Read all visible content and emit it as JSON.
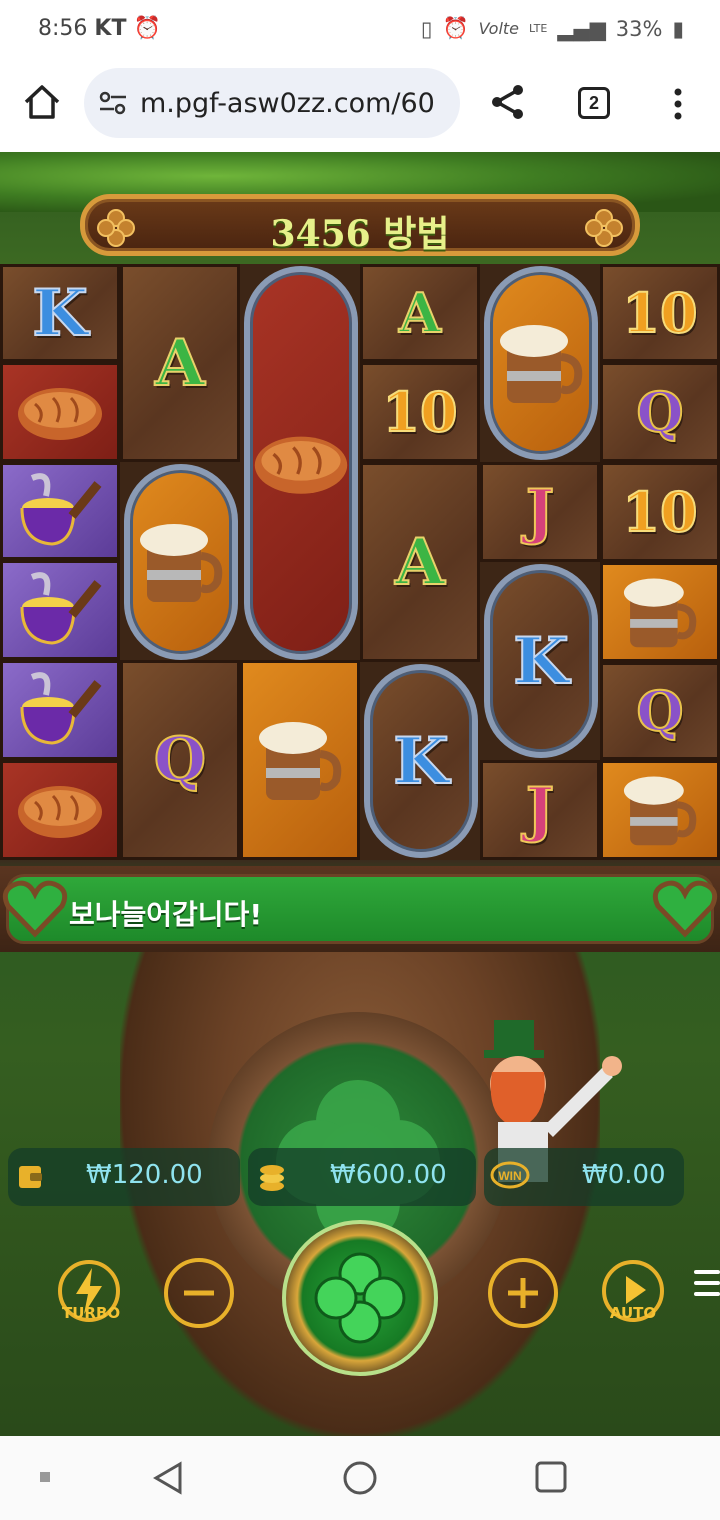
{
  "status_bar": {
    "time": "8:56",
    "carrier": "KT",
    "battery": "33%",
    "network": "LTE"
  },
  "browser": {
    "url": "m.pgf-asw0zz.com/60",
    "tab_count": "2"
  },
  "game": {
    "ways_text": "3456 방법",
    "message": "보나늘어갑니다!",
    "balance": "₩120.00",
    "bet": "₩600.00",
    "win": "₩0.00",
    "turbo_label": "TURBO",
    "auto_label": "AUTO",
    "win_badge": "WIN",
    "accent_color": "#2fa83a",
    "gold_color": "#e8b12a",
    "reels": [
      [
        "K",
        "bread",
        "pot",
        "pot",
        "pot",
        "bread"
      ],
      [
        "A",
        "ale",
        "Q"
      ],
      [
        "bread",
        "ale"
      ],
      [
        "A",
        "10",
        "A",
        "K"
      ],
      [
        "ale",
        "J",
        "K",
        "J"
      ],
      [
        "10",
        "Q",
        "10",
        "ale",
        "Q",
        "ale"
      ]
    ]
  }
}
